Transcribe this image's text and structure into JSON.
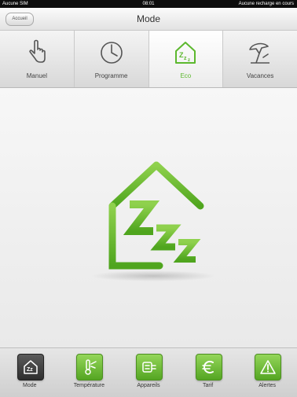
{
  "status_bar": {
    "carrier": "Aucune SIM",
    "time": "08:01",
    "battery": "Aucune recharge en cours"
  },
  "nav": {
    "back_label": "Accueil",
    "title": "Mode"
  },
  "mode_tabs": [
    {
      "label": "Manuel",
      "icon": "hand-pointer-icon",
      "active": false
    },
    {
      "label": "Programme",
      "icon": "clock-icon",
      "active": false
    },
    {
      "label": "Eco",
      "icon": "eco-house-icon",
      "active": true
    },
    {
      "label": "Vacances",
      "icon": "beach-umbrella-icon",
      "active": false
    }
  ],
  "main": {
    "icon": "eco-house-sleep-icon"
  },
  "toolbar": [
    {
      "label": "Mode",
      "icon": "mode-icon",
      "active": true
    },
    {
      "label": "Température",
      "icon": "thermometer-icon",
      "active": false
    },
    {
      "label": "Appareils",
      "icon": "appliance-icon",
      "active": false
    },
    {
      "label": "Tarif",
      "icon": "euro-icon",
      "active": false
    },
    {
      "label": "Alertes",
      "icon": "alert-icon",
      "active": false
    }
  ],
  "colors": {
    "accent_green": "#5cb82e",
    "active_dark": "#3a3a3a"
  }
}
